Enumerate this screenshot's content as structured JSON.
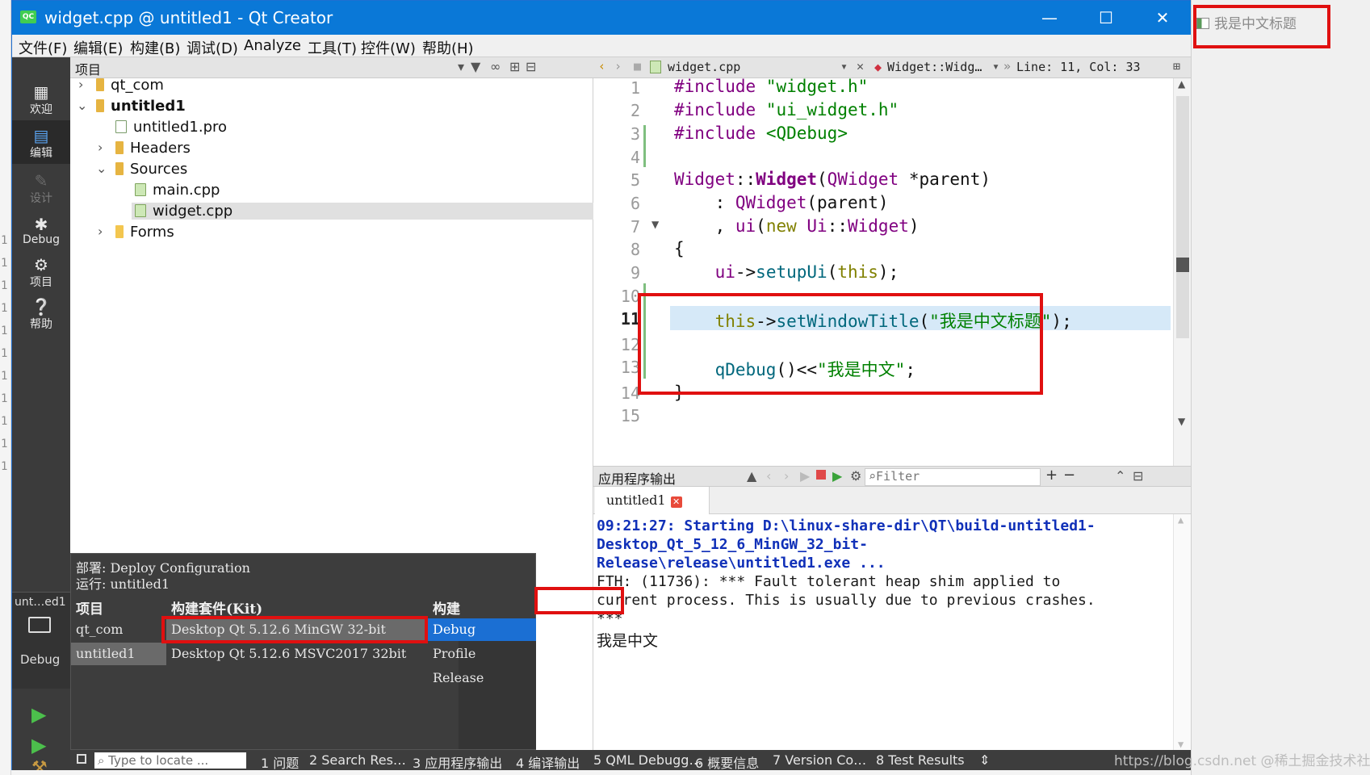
{
  "background_window": {
    "line_marks": [
      "1",
      "1",
      "1",
      "1",
      "1",
      "1",
      "1",
      "1",
      "1",
      "1",
      "1"
    ]
  },
  "window": {
    "title": "widget.cpp @ untitled1 - Qt Creator",
    "logo_text": "QC"
  },
  "menu": [
    "文件(F)",
    "编辑(E)",
    "构建(B)",
    "调试(D)",
    "Analyze",
    "工具(T)",
    "控件(W)",
    "帮助(H)"
  ],
  "modes": {
    "welcome": "欢迎",
    "edit": "编辑",
    "design": "设计",
    "debug": "Debug",
    "projects": "项目",
    "help": "帮助"
  },
  "kit_selector": {
    "project": "unt…ed1",
    "build": "Debug"
  },
  "project_pane": {
    "title": "项目",
    "tree": {
      "qt_com": "qt_com",
      "untitled1": "untitled1",
      "pro": "untitled1.pro",
      "headers": "Headers",
      "sources": "Sources",
      "main": "main.cpp",
      "widget": "widget.cpp",
      "forms": "Forms"
    }
  },
  "kit_popup": {
    "deploy": "部署: Deploy Configuration",
    "run": "运行: untitled1",
    "col_project": "项目",
    "col_kit": "构建套件(Kit)",
    "col_build": "构建",
    "projects": [
      "qt_com",
      "untitled1"
    ],
    "kits": [
      "Desktop Qt 5.12.6 MinGW 32-bit",
      "Desktop Qt 5.12.6 MSVC2017 32bit"
    ],
    "builds": [
      "Debug",
      "Profile",
      "Release"
    ]
  },
  "editor": {
    "file": "widget.cpp",
    "symbol": "Widget::Widg…",
    "position": "Line: 11, Col: 33",
    "line_numbers": [
      "1",
      "2",
      "3",
      "4",
      "5",
      "6",
      "7",
      "8",
      "9",
      "10",
      "11",
      "12",
      "13",
      "14",
      "15"
    ],
    "current_line": "11"
  },
  "output": {
    "pane_title": "应用程序输出",
    "filter_placeholder": "Filter",
    "tab": "untitled1",
    "lines": [
      "09:21:27: Starting D:\\linux-share-dir\\QT\\build-untitled1-",
      "Desktop_Qt_5_12_6_MinGW_32_bit-",
      "Release\\release\\untitled1.exe ...",
      "FTH: (11736): *** Fault tolerant heap shim applied to",
      "current process. This is usually due to previous crashes.",
      "***",
      "我是中文"
    ]
  },
  "statusbar": {
    "locator_placeholder": "Type to locate ...",
    "tabs": [
      "1 问题",
      "2 Search Res…",
      "3 应用程序输出",
      "4 编译输出",
      "5 QML Debugg…",
      "6 概要信息",
      "7 Version Co…",
      "8 Test Results"
    ]
  },
  "app_window": {
    "title": "我是中文标题"
  },
  "watermark": "https://blog.csdn.net @稀土掘金技术社区",
  "colors": {
    "title_blue": "#0a78d7",
    "highlight_red": "#e01010",
    "selection_blue": "#1b6fd3"
  }
}
